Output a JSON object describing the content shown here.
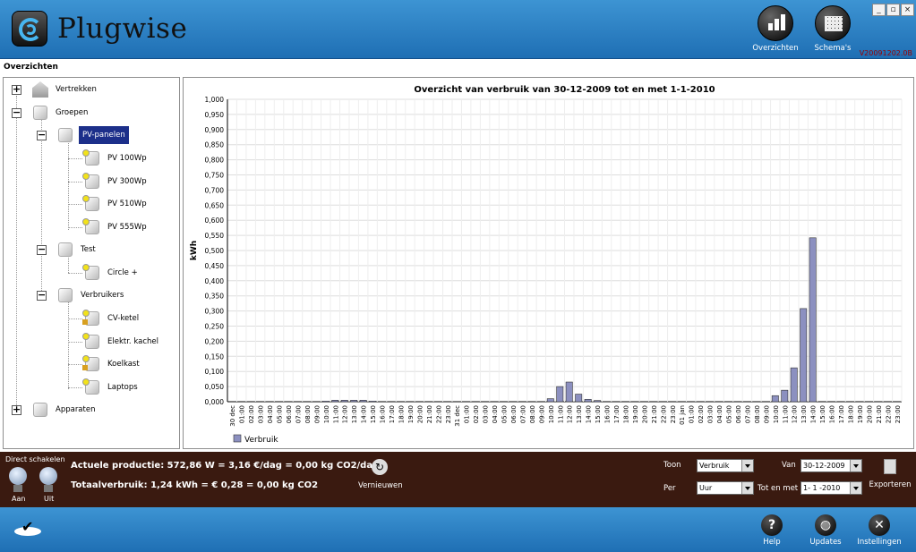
{
  "app": {
    "title": "Plugwise",
    "version": "V20091202.0B"
  },
  "top_buttons": {
    "overzichten": "Overzichten",
    "schemas": "Schema's"
  },
  "window_controls": {
    "minimize": "_",
    "restore": "▫",
    "close": "×"
  },
  "section_label": "Overzichten",
  "tree": {
    "vertrekken": "Vertrekken",
    "groepen": "Groepen",
    "pv_panelen": "PV-panelen",
    "pv100": "PV 100Wp",
    "pv300": "PV 300Wp",
    "pv510": "PV 510Wp",
    "pv555": "PV 555Wp",
    "test": "Test",
    "circle_plus": "Circle +",
    "verbruikers": "Verbruikers",
    "cv_ketel": "CV-ketel",
    "elektr_kachel": "Elektr. kachel",
    "koelkast": "Koelkast",
    "laptops": "Laptops",
    "apparaten": "Apparaten",
    "plus": "+",
    "minus": "−"
  },
  "chart_data": {
    "type": "bar",
    "title": "Overzicht van verbruik van 30-12-2009 tot en met 1-1-2010",
    "ylabel": "kWh",
    "xlabel": "",
    "ylim": [
      0,
      1
    ],
    "yticks": [
      "0,000",
      "0,050",
      "0,100",
      "0,150",
      "0,200",
      "0,250",
      "0,300",
      "0,350",
      "0,400",
      "0,450",
      "0,500",
      "0,550",
      "0,600",
      "0,650",
      "0,700",
      "0,750",
      "0,800",
      "0,850",
      "0,900",
      "0,950",
      "1,000"
    ],
    "categories": [
      "30 dec",
      "01:00",
      "02:00",
      "03:00",
      "04:00",
      "05:00",
      "06:00",
      "07:00",
      "08:00",
      "09:00",
      "10:00",
      "11:00",
      "12:00",
      "13:00",
      "14:00",
      "15:00",
      "16:00",
      "17:00",
      "18:00",
      "19:00",
      "20:00",
      "21:00",
      "22:00",
      "23:00",
      "31 dec",
      "01:00",
      "02:00",
      "03:00",
      "04:00",
      "05:00",
      "06:00",
      "07:00",
      "08:00",
      "09:00",
      "10:00",
      "11:00",
      "12:00",
      "13:00",
      "14:00",
      "15:00",
      "16:00",
      "17:00",
      "18:00",
      "19:00",
      "20:00",
      "21:00",
      "22:00",
      "23:00",
      "01 jan",
      "01:00",
      "02:00",
      "03:00",
      "04:00",
      "05:00",
      "06:00",
      "07:00",
      "08:00",
      "09:00",
      "10:00",
      "11:00",
      "12:00",
      "13:00",
      "14:00",
      "15:00",
      "16:00",
      "17:00",
      "18:00",
      "19:00",
      "20:00",
      "21:00",
      "22:00",
      "23:00"
    ],
    "series": [
      {
        "name": "Verbruik",
        "color": "#8c90c0",
        "values": [
          0,
          0,
          0,
          0,
          0,
          0,
          0,
          0,
          0,
          0,
          0.002,
          0.005,
          0.005,
          0.005,
          0.005,
          0.002,
          0,
          0,
          0,
          0,
          0,
          0,
          0,
          0,
          0,
          0,
          0,
          0,
          0,
          0,
          0,
          0,
          0,
          0,
          0.01,
          0.05,
          0.065,
          0.025,
          0.008,
          0.004,
          0,
          0,
          0,
          0,
          0,
          0,
          0,
          0,
          0,
          0,
          0,
          0,
          0,
          0,
          0,
          0,
          0,
          0,
          0.02,
          0.038,
          0.112,
          0.308,
          0.542,
          0,
          0,
          0,
          0,
          0,
          0,
          0,
          0,
          0
        ]
      }
    ],
    "grid": true,
    "legend": "bottom-left"
  },
  "status": {
    "direct_schakelen": "Direct schakelen",
    "aan": "Aan",
    "uit": "Uit",
    "productie": "Actuele productie: 572,86 W = 3,16 €/dag = 0,00 kg CO2/dag",
    "totaal": "Totaalverbruik: 1,24 kWh = € 0,28 = 0,00 kg CO2",
    "vernieuwen": "Vernieuwen",
    "toon_label": "Toon",
    "toon_value": "Verbruik",
    "per_label": "Per",
    "per_value": "Uur",
    "van_label": "Van",
    "van_value": "30-12-2009",
    "tot_label": "Tot en met",
    "tot_value": "1- 1 -2010",
    "exporteren": "Exporteren"
  },
  "bottom": {
    "help": "Help",
    "updates": "Updates",
    "instellingen": "Instellingen"
  }
}
